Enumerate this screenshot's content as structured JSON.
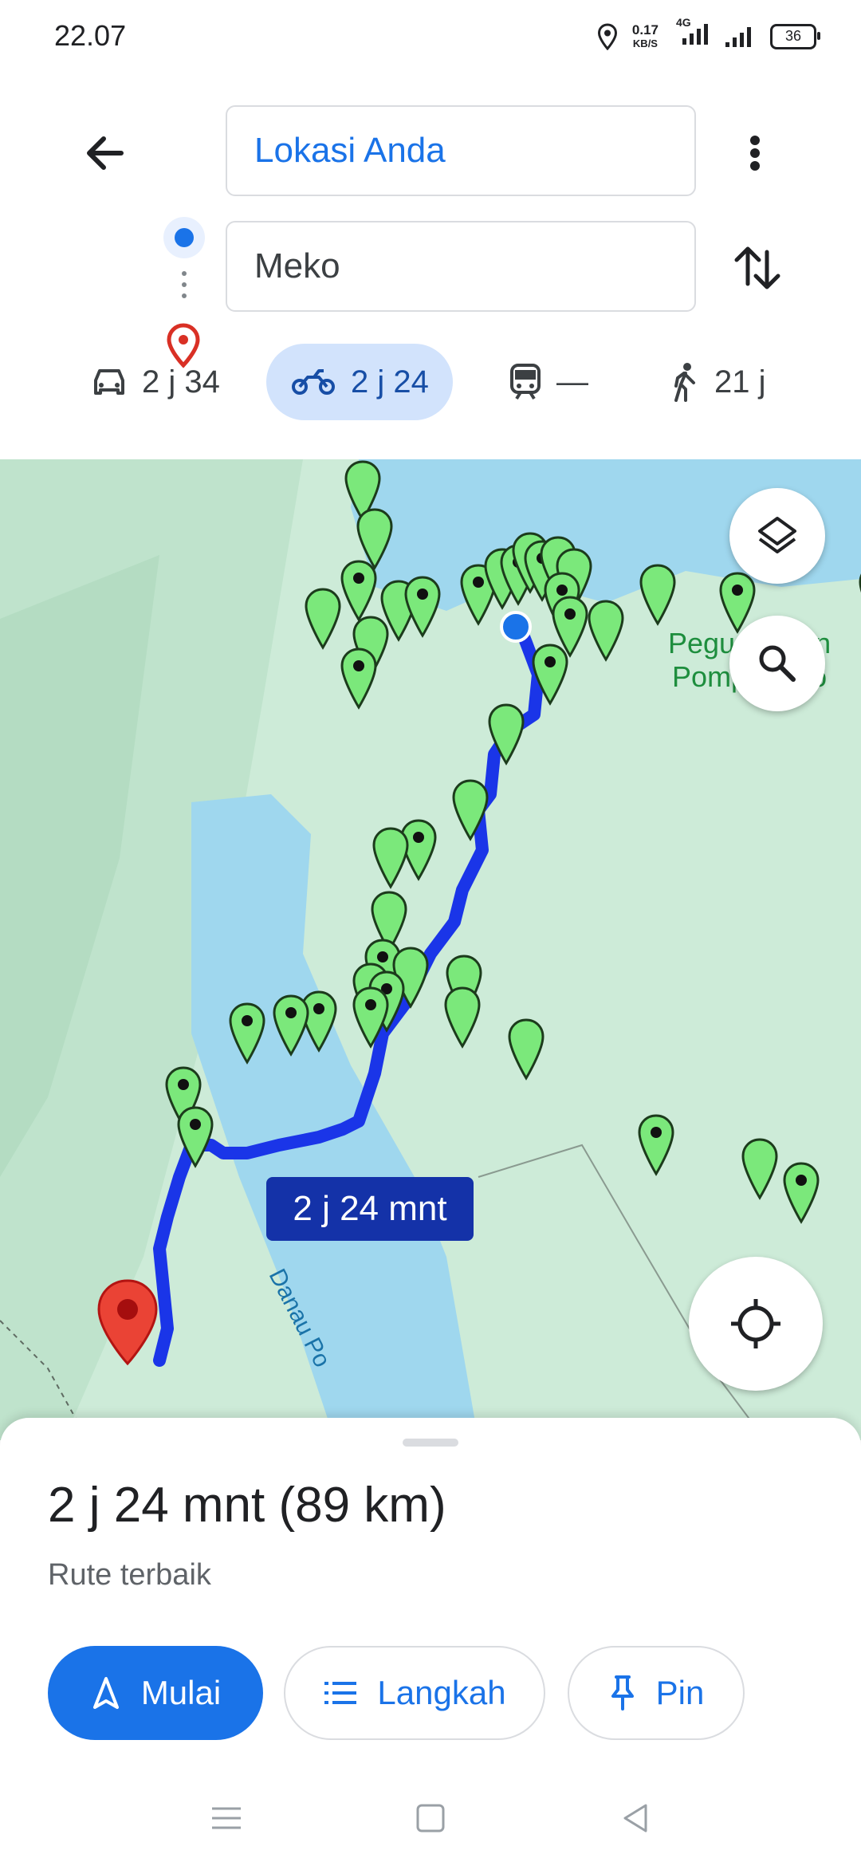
{
  "status_bar": {
    "time": "22.07",
    "net_speed": "0.17",
    "net_unit": "KB/S",
    "network_type": "4G",
    "battery": "36",
    "icons": [
      "location-icon",
      "signal-icon",
      "signal-icon-2",
      "battery-icon"
    ]
  },
  "route": {
    "origin": "Lokasi Anda",
    "destination": "Meko"
  },
  "modes": [
    {
      "name": "car",
      "icon": "car-icon",
      "label": "2 j 34"
    },
    {
      "name": "motorcycle",
      "icon": "motorcycle-icon",
      "label": "2 j 24",
      "selected": true
    },
    {
      "name": "transit",
      "icon": "train-icon",
      "label": "—"
    },
    {
      "name": "walk",
      "icon": "walk-icon",
      "label": "21 j"
    }
  ],
  "map": {
    "route_duration_label": "2 j 24 mnt",
    "place_label": "Pegunungan\nPompangeo",
    "lake_label": "Danau Po",
    "colors": {
      "land": "#cdebd8",
      "water": "#9fd7ee",
      "route": "#1a35e8",
      "marker": "#7be87b",
      "dest_pin": "#ea4335"
    }
  },
  "sheet": {
    "summary": "2 j 24 mnt (89 km)",
    "subtitle": "Rute terbaik",
    "buttons": {
      "start": "Mulai",
      "steps": "Langkah",
      "pin": "Pin"
    }
  },
  "colors": {
    "accent": "#1a73e8",
    "selected_mode_bg": "#d2e3fc"
  }
}
